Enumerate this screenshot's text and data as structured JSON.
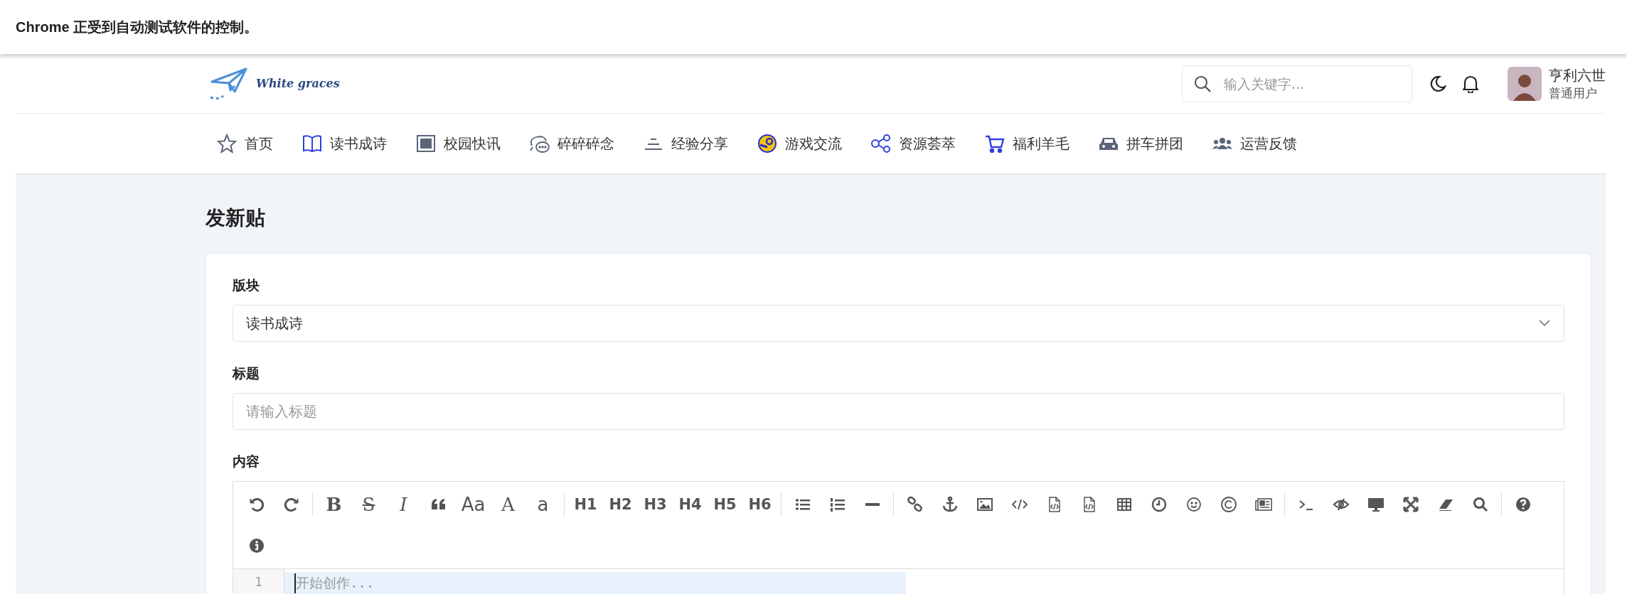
{
  "banner": {
    "text": "Chrome 正受到自动测试软件的控制。"
  },
  "header": {
    "logo_text": "White graces",
    "search": {
      "placeholder": "输入关键字..."
    },
    "user": {
      "name": "亨利六世",
      "role": "普通用户"
    }
  },
  "nav": [
    {
      "label": "首页",
      "kind": "star"
    },
    {
      "label": "读书成诗",
      "kind": "book"
    },
    {
      "label": "校园快讯",
      "kind": "news"
    },
    {
      "label": "碎碎碎念",
      "kind": "chat"
    },
    {
      "label": "经验分享",
      "kind": "stack"
    },
    {
      "label": "游戏交流",
      "kind": "game"
    },
    {
      "label": "资源荟萃",
      "kind": "share"
    },
    {
      "label": "福利羊毛",
      "kind": "cart"
    },
    {
      "label": "拼车拼团",
      "kind": "car"
    },
    {
      "label": "运营反馈",
      "kind": "users"
    }
  ],
  "page_title": "发新贴",
  "form": {
    "board": {
      "label": "版块",
      "value": "读书成诗"
    },
    "title": {
      "label": "标题",
      "placeholder": "请输入标题"
    },
    "content": {
      "label": "内容",
      "line_number": "1",
      "placeholder": "开始创作..."
    }
  },
  "toolbar": [
    [
      {
        "kind": "undo"
      },
      {
        "kind": "redo"
      }
    ],
    [
      {
        "kind": "bold",
        "label": "B"
      },
      {
        "kind": "strike",
        "label": "S"
      },
      {
        "kind": "italic",
        "label": "I"
      },
      {
        "kind": "quote"
      },
      {
        "kind": "sans",
        "label": "Aa"
      },
      {
        "kind": "serif",
        "label": "A"
      },
      {
        "kind": "sans",
        "label": "a"
      }
    ],
    [
      {
        "kind": "heading",
        "label": "H1"
      },
      {
        "kind": "heading",
        "label": "H2"
      },
      {
        "kind": "heading",
        "label": "H3"
      },
      {
        "kind": "heading",
        "label": "H4"
      },
      {
        "kind": "heading",
        "label": "H5"
      },
      {
        "kind": "heading",
        "label": "H6"
      }
    ],
    [
      {
        "kind": "ul"
      },
      {
        "kind": "ol"
      },
      {
        "kind": "hr"
      }
    ],
    [
      {
        "kind": "link"
      },
      {
        "kind": "anchor"
      },
      {
        "kind": "image"
      },
      {
        "kind": "code"
      },
      {
        "kind": "file"
      },
      {
        "kind": "file"
      },
      {
        "kind": "table"
      },
      {
        "kind": "clock"
      },
      {
        "kind": "smile"
      },
      {
        "kind": "copyright"
      },
      {
        "kind": "newspaper"
      }
    ],
    [
      {
        "kind": "terminal"
      },
      {
        "kind": "eyeslash"
      },
      {
        "kind": "desktop"
      },
      {
        "kind": "expand"
      },
      {
        "kind": "eraser"
      },
      {
        "kind": "search"
      }
    ],
    [
      {
        "kind": "help"
      }
    ],
    [
      {
        "kind": "info"
      }
    ]
  ]
}
